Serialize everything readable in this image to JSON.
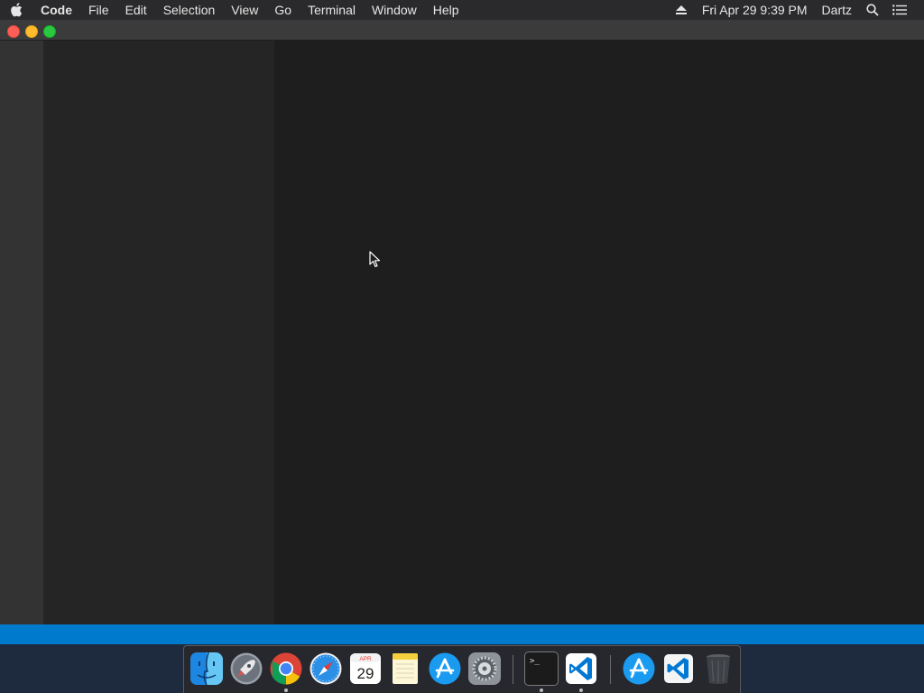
{
  "menubar": {
    "app_name": "Code",
    "items": [
      "File",
      "Edit",
      "Selection",
      "View",
      "Go",
      "Terminal",
      "Window",
      "Help"
    ],
    "clock": "Fri Apr 29  9:39 PM",
    "user": "Dartz",
    "status_icons": [
      "eject-icon",
      "spotlight-search-icon",
      "notification-center-icon"
    ]
  },
  "window": {
    "title": "",
    "traffic_lights": [
      "close",
      "minimize",
      "maximize"
    ]
  },
  "theme": {
    "statusbar_color": "#007acc",
    "activitybar_color": "#333333",
    "sidebar_color": "#252526",
    "editor_color": "#1e1e1e"
  },
  "dock": {
    "apps": [
      {
        "name": "Finder",
        "icon": "finder-icon",
        "running": false
      },
      {
        "name": "Launchpad",
        "icon": "launchpad-icon",
        "running": false
      },
      {
        "name": "Google Chrome",
        "icon": "chrome-icon",
        "running": true
      },
      {
        "name": "Safari",
        "icon": "safari-icon",
        "running": false
      },
      {
        "name": "Calendar",
        "icon": "calendar-icon",
        "running": false,
        "month": "APR",
        "day": "29"
      },
      {
        "name": "Notes",
        "icon": "notes-icon",
        "running": false
      },
      {
        "name": "App Store",
        "icon": "app-store-icon",
        "running": false
      },
      {
        "name": "System Preferences",
        "icon": "system-preferences-icon",
        "running": false
      },
      {
        "name": "Terminal",
        "icon": "terminal-icon",
        "running": true,
        "prompt": ">_"
      },
      {
        "name": "Visual Studio Code",
        "icon": "vscode-icon",
        "running": true
      },
      {
        "name": "App Store Download",
        "icon": "app-store-folder-icon",
        "running": false
      },
      {
        "name": "Visual Studio Code Folder",
        "icon": "vscode-folder-icon",
        "running": false
      },
      {
        "name": "Trash",
        "icon": "trash-icon",
        "running": false
      }
    ]
  }
}
